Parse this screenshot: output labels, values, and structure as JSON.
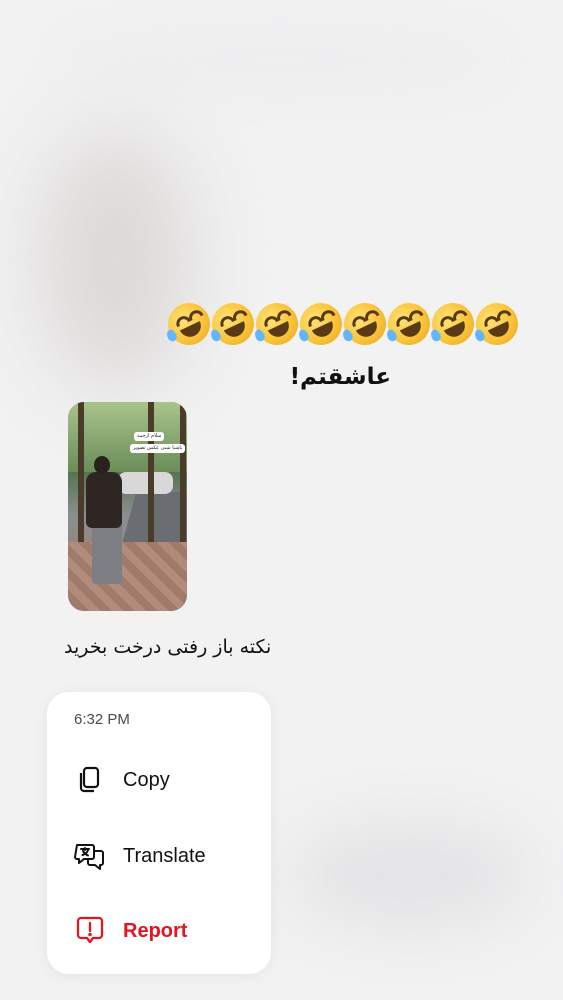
{
  "messages": {
    "emoji_reaction": "🤣🤣🤣🤣🤣🤣🤣🤣",
    "emoji_count": 8,
    "text_1": "عاشقتم!",
    "story_sticker_line1": "سلام ازجمه",
    "story_sticker_line2": "باشبا شبی عکس تصویر",
    "text_2": "نکته باز رفتی درخت بخرید"
  },
  "context_menu": {
    "timestamp": "6:32 PM",
    "items": [
      {
        "label": "Copy",
        "icon": "copy-icon",
        "color": "#111111"
      },
      {
        "label": "Translate",
        "icon": "translate-icon",
        "color": "#111111"
      },
      {
        "label": "Report",
        "icon": "report-icon",
        "color": "#e5141e"
      }
    ]
  }
}
